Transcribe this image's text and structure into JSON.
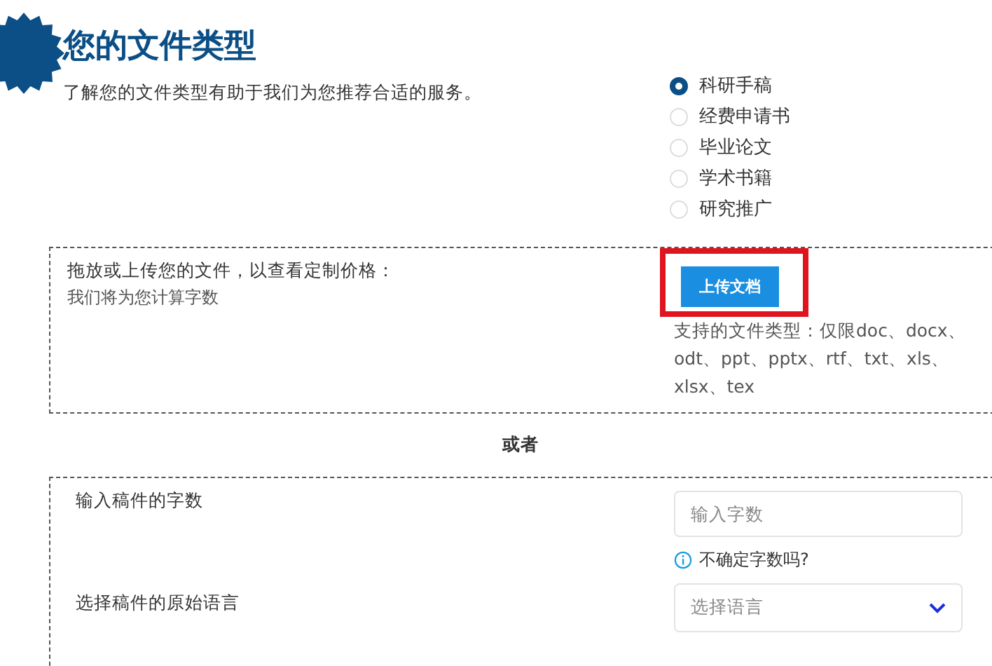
{
  "header": {
    "title": "您的文件类型",
    "subtitle": "了解您的文件类型有助于我们为您推荐合适的服务。"
  },
  "document_types": [
    {
      "label": "科研手稿",
      "selected": true
    },
    {
      "label": "经费申请书",
      "selected": false
    },
    {
      "label": "毕业论文",
      "selected": false
    },
    {
      "label": "学术书籍",
      "selected": false
    },
    {
      "label": "研究推广",
      "selected": false
    }
  ],
  "upload": {
    "title": "拖放或上传您的文件，以查看定制价格：",
    "note": "我们将为您计算字数",
    "button": "上传文档",
    "highlighted": true,
    "formats": "支持的文件类型：仅限doc、docx、odt、ppt、pptx、rtf、txt、xls、xlsx、tex"
  },
  "divider": "或者",
  "manual": {
    "word_count_label": "输入稿件的字数",
    "word_count_placeholder": "输入字数",
    "hint": "不确定字数吗?",
    "language_label": "选择稿件的原始语言",
    "language_placeholder": "选择语言"
  }
}
